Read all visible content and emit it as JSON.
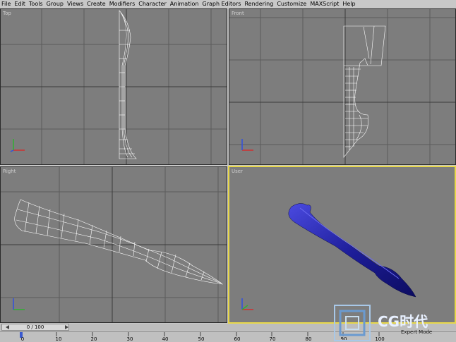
{
  "menu": [
    "File",
    "Edit",
    "Tools",
    "Group",
    "Views",
    "Create",
    "Modifiers",
    "Character",
    "Animation",
    "Graph Editors",
    "Rendering",
    "Customize",
    "MAXScript",
    "Help"
  ],
  "viewports": {
    "top": {
      "label": "Top"
    },
    "front": {
      "label": "Front"
    },
    "right": {
      "label": "Right"
    },
    "user": {
      "label": "User"
    }
  },
  "timeline": {
    "frame_counter": "0 / 100",
    "ticks": [
      "0",
      "10",
      "20",
      "30",
      "40",
      "50",
      "60",
      "70",
      "80",
      "90",
      "100"
    ]
  },
  "status": {
    "mode_text": "Expert Mode"
  },
  "watermark": {
    "text": "CG时代"
  },
  "colors": {
    "viewport_bg": "#7d7d7d",
    "grid": "#5c5c5c",
    "active_border": "#e8d84a",
    "wireframe": "#ffffff",
    "shaded_model": "#2a2ab8"
  }
}
